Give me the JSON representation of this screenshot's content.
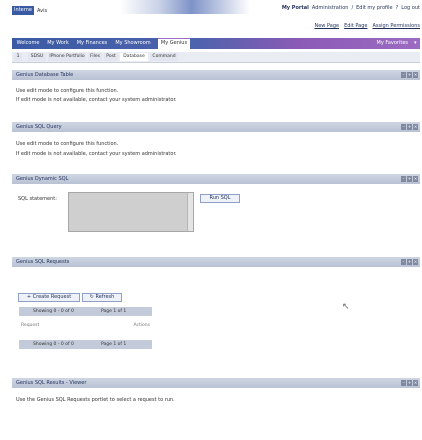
{
  "header": {
    "logo_text": "Interne",
    "logo_sub": "Avis",
    "top_links": [
      "My Portal",
      "Administration",
      "/",
      "Edit my profile",
      "?",
      "Log out"
    ],
    "sub_links": [
      "New Page",
      "Edit Page",
      "Assign Permissions"
    ]
  },
  "tabs": [
    "Welcome",
    "My Work",
    "My Finances",
    "My Showroom",
    "My Genius"
  ],
  "favorites_label": "My Favorites",
  "subtabs": [
    "1",
    "SDSU",
    "IPhone Portfolio",
    "Files",
    "Post",
    "Database",
    "Command"
  ],
  "panels": {
    "database_table": {
      "title": "Genius Database Table",
      "line1": "Use edit mode to configure this function.",
      "line2": "If edit mode is not available, contact your system administrator."
    },
    "sql_query": {
      "title": "Genius SQL Query",
      "line1": "Use edit mode to configure this function.",
      "line2": "If edit mode is not available, contact your system administrator."
    },
    "dynamic_sql": {
      "title": "Genius Dynamic SQL",
      "statement_label": "SQL statement:",
      "run_button": "Run SQL"
    },
    "sql_requests": {
      "title": "Genius SQL Requests",
      "create_button": "Create Request",
      "refresh_button": "Refresh",
      "showing_top": "Showing 0 - 0 of 0",
      "page_top": "Page 1 of 1",
      "col_request": "Request",
      "col_actions": "Actions",
      "showing_bottom": "Showing 0 - 0 of 0",
      "page_bottom": "Page 1 of 1"
    },
    "sql_results": {
      "title": "Genius SQL Results - Viewer",
      "line1": "Use the Genius SQL Requests portlet to select a request to run."
    }
  },
  "colors": {
    "tab_blue": "#3b5aa5",
    "tab_purple": "#7d4fb3",
    "portlet_bar": "#c3cbdb"
  }
}
